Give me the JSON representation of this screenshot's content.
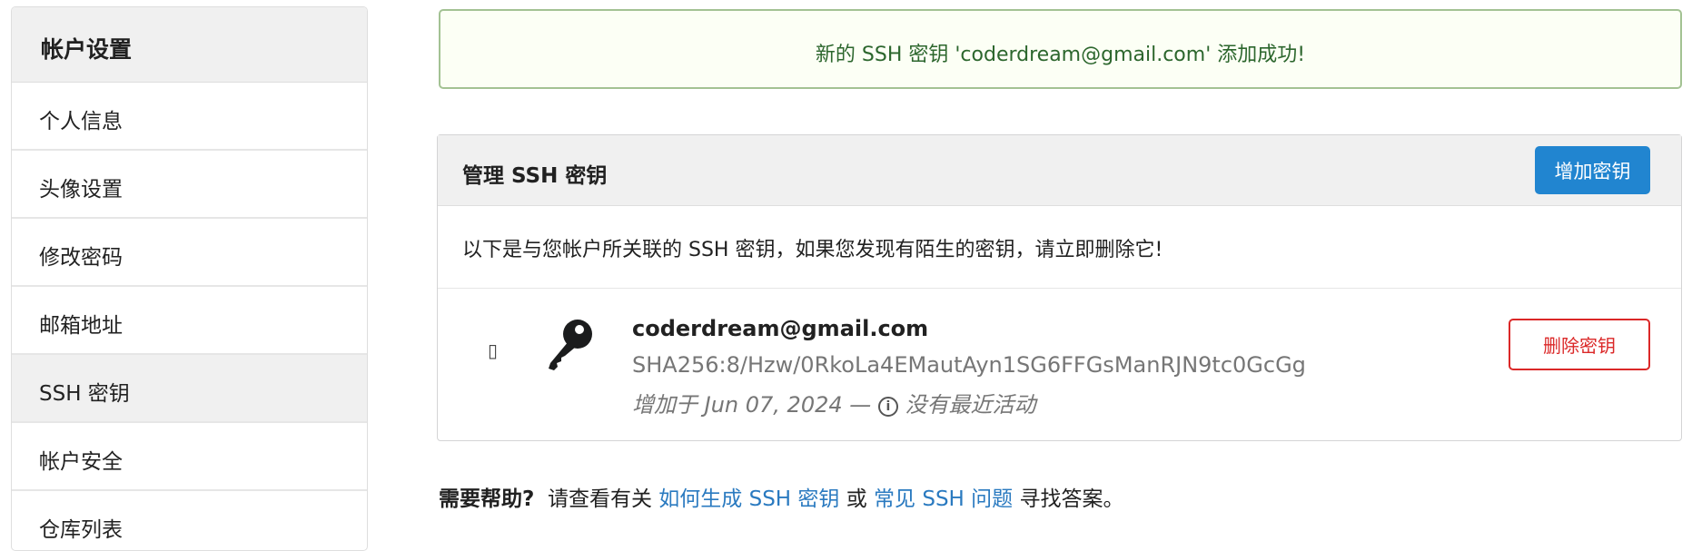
{
  "sidebar": {
    "title": "帐户设置",
    "items": [
      {
        "label": "个人信息"
      },
      {
        "label": "头像设置"
      },
      {
        "label": "修改密码"
      },
      {
        "label": "邮箱地址"
      },
      {
        "label": "SSH 密钥",
        "active": true
      },
      {
        "label": "帐户安全"
      },
      {
        "label": "仓库列表"
      }
    ]
  },
  "alert": {
    "message": "新的 SSH 密钥 'coderdream@gmail.com' 添加成功!"
  },
  "panel": {
    "title": "管理 SSH 密钥",
    "add_button": "增加密钥",
    "description": "以下是与您帐户所关联的 SSH 密钥，如果您发现有陌生的密钥，请立即删除它!",
    "keys": [
      {
        "name": "coderdream@gmail.com",
        "fingerprint": "SHA256:8/Hzw/0RkoLa4EMautAyn1SG6FFGsManRJN9tc0GcGg",
        "added": "增加于 Jun 07, 2024 —",
        "activity": "没有最近活动",
        "delete_button": "删除密钥",
        "checkbox_glyph": "▯"
      }
    ]
  },
  "help": {
    "lead": "需要帮助?",
    "text1": "请查看有关",
    "link1": "如何生成 SSH 密钥",
    "or": "或",
    "link2": "常见 SSH 问题",
    "text2": "寻找答案。"
  }
}
